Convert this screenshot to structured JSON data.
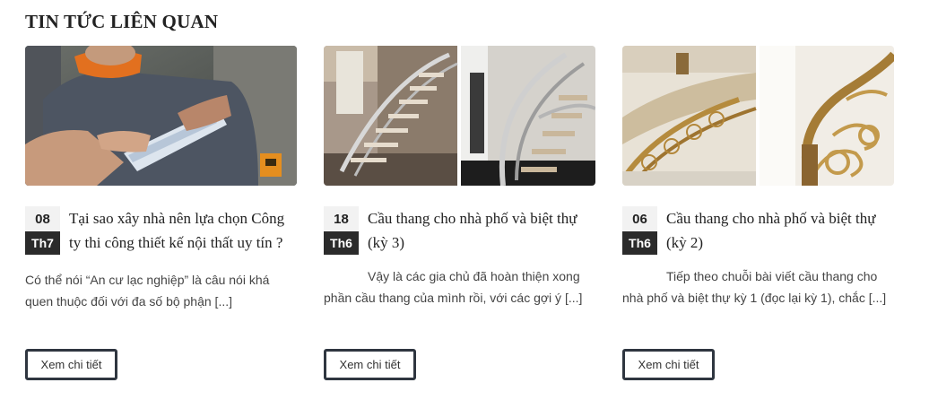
{
  "section": {
    "title": "TIN TỨC LIÊN QUAN"
  },
  "posts": [
    {
      "day": "08",
      "month": "Th7",
      "title": "Tại sao xây nhà nên lựa chọn Công ty thi công thiết kế nội thất uy tín ?",
      "excerpt": "Có thể nói “An cư lạc nghiệp” là câu nói khá quen thuộc đối với đa số bộ phận [...]",
      "button": "Xem chi tiết"
    },
    {
      "day": "18",
      "month": "Th6",
      "title": "Cầu thang cho nhà phố và biệt thự (kỳ 3)",
      "excerpt": "Vậy là các gia chủ đã hoàn thiện xong phần cầu thang của mình rồi, với các gợi ý [...]",
      "button": "Xem chi tiết"
    },
    {
      "day": "06",
      "month": "Th6",
      "title": "Cầu thang cho nhà phố và biệt thự (kỳ 2)",
      "excerpt": "Tiếp theo chuỗi bài viết cầu thang cho nhà phố và biệt thự kỳ 1 (đọc lại kỳ 1), chắc [...]",
      "button": "Xem chi tiết"
    }
  ]
}
